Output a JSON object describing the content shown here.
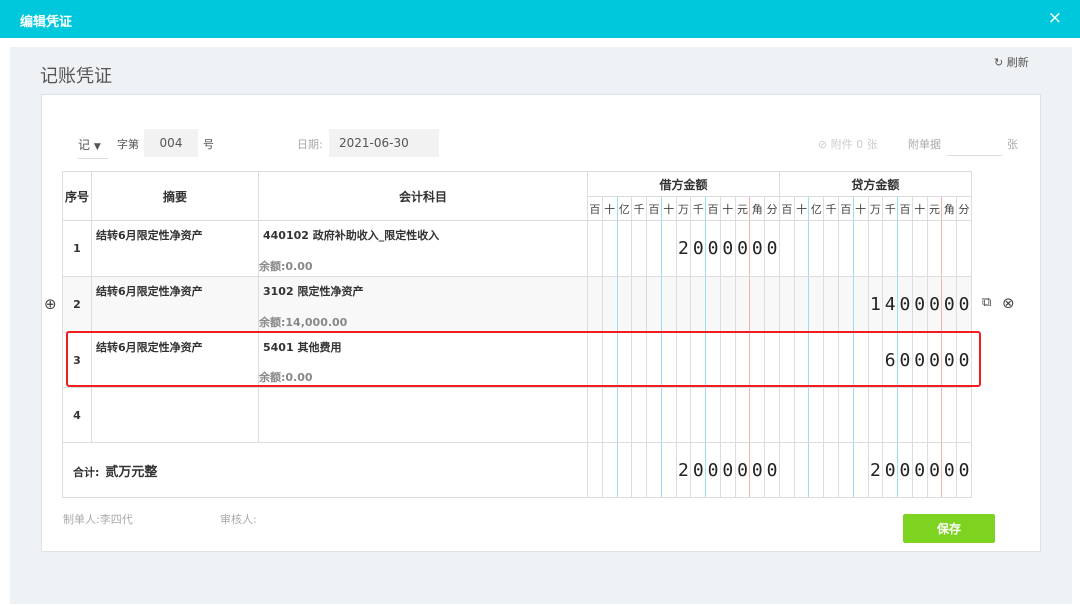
{
  "window": {
    "title": "编辑凭证",
    "close": "×"
  },
  "page": {
    "title": "记账凭证",
    "refresh": "刷新"
  },
  "header": {
    "type": "记",
    "zi_di": "字第",
    "number": "004",
    "hao": "号",
    "date_label": "日期:",
    "date": "2021-06-30",
    "attachment": "附件 0 张",
    "attach_doc_label": "附单据",
    "attach_doc_value": "",
    "zhang": "张"
  },
  "table": {
    "col_seq": "序号",
    "col_summary": "摘要",
    "col_account": "会计科目",
    "col_debit": "借方金额",
    "col_credit": "贷方金额",
    "digits": [
      "百",
      "十",
      "亿",
      "千",
      "百",
      "十",
      "万",
      "千",
      "百",
      "十",
      "元",
      "角",
      "分"
    ],
    "rows": [
      {
        "seq": "1",
        "summary": "结转6月限定性净资产",
        "account": "440102 政府补助收入_限定性收入",
        "balance": "余额:0.00",
        "debit": "2000000",
        "credit": ""
      },
      {
        "seq": "2",
        "summary": "结转6月限定性净资产",
        "account": "3102 限定性净资产",
        "balance": "余额:14,000.00",
        "debit": "",
        "credit": "1400000"
      },
      {
        "seq": "3",
        "summary": "结转6月限定性净资产",
        "account": "5401 其他费用",
        "balance": "余额:0.00",
        "debit": "",
        "credit": "600000"
      },
      {
        "seq": "4",
        "summary": "",
        "account": "",
        "balance": "",
        "debit": "",
        "credit": ""
      }
    ],
    "total_label": "合计:",
    "total_words": "贰万元整",
    "total_debit": "2000000",
    "total_credit": "2000000"
  },
  "footer": {
    "maker_label": "制单人:",
    "maker": "李四代",
    "reviewer_label": "审核人:",
    "reviewer": "",
    "save": "保存"
  }
}
